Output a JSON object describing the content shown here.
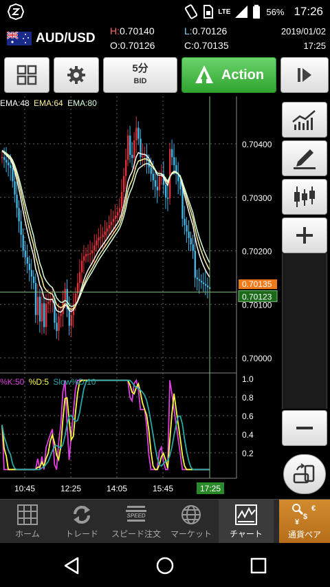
{
  "status_bar": {
    "battery_percent": "56%",
    "time": "17:26",
    "network": "LTE"
  },
  "quote": {
    "pair": "AUD/USD",
    "high_label": "H:",
    "high": "0.70140",
    "low_label": "L:",
    "low": "0.70126",
    "open_label": "O:",
    "open": "0.70126",
    "close_label": "C:",
    "close": "0.70135",
    "date": "2019/01/02",
    "time": "17:25"
  },
  "toolbar": {
    "timeframe": "5分",
    "price_type": "BID",
    "action_label": "Action"
  },
  "chart": {
    "ema_labels": [
      "EMA:48",
      "EMA:64",
      "EMA:80"
    ],
    "ema_colors": [
      "#ffffff",
      "#fff59a",
      "#d8ffe0"
    ],
    "price_ticks": [
      "0.70400",
      "0.70300",
      "0.70200",
      "0.70100",
      "0.70000"
    ],
    "current_price_ask": "0.70135",
    "current_price_bid": "0.70123",
    "osc_labels": [
      "%K:50",
      "%D:5",
      "Slow%D:10"
    ],
    "osc_colors": [
      "#e040e0",
      "#ffff40",
      "#2aa8a8"
    ],
    "osc_ticks": [
      "1.0",
      "0.8",
      "0.6",
      "0.4",
      "0.2"
    ],
    "time_ticks": [
      "10:45",
      "12:25",
      "14:05",
      "15:45"
    ],
    "current_time": "17:25",
    "up_color": "#e0303a",
    "down_color": "#3fb8e8"
  },
  "bottom_nav": [
    {
      "label": "ホーム",
      "icon": "home-grid-icon"
    },
    {
      "label": "トレード",
      "icon": "trade-arrows-icon"
    },
    {
      "label": "スピード注文",
      "icon": "speed-icon"
    },
    {
      "label": "マーケット",
      "icon": "globe-icon"
    },
    {
      "label": "チャート",
      "icon": "chart-icon"
    },
    {
      "label": "通貨ペア",
      "icon": "currency-icon"
    }
  ]
}
